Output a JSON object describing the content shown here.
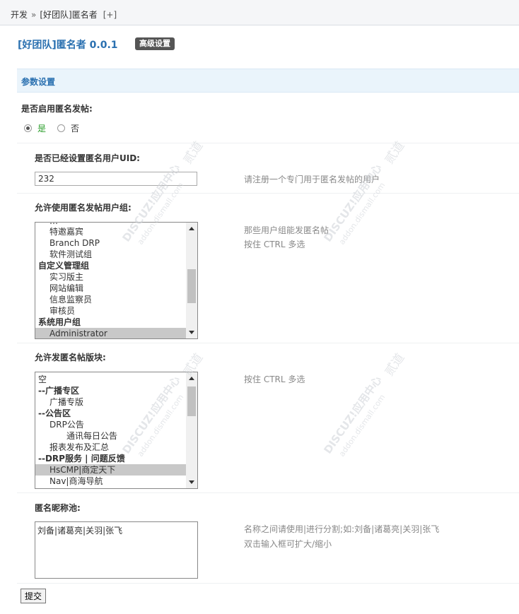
{
  "breadcrumb": {
    "root": "开发",
    "separator": "»",
    "current": "[好团队]匿名者",
    "add": "[+]"
  },
  "header": {
    "title": "[好团队]匿名者 0.0.1",
    "advanced_button": "高级设置"
  },
  "section": {
    "title": "参数设置"
  },
  "enable_anonymous": {
    "label": "是否启用匿名发帖:",
    "options": [
      {
        "label": "是",
        "selected": true
      },
      {
        "label": "否",
        "selected": false
      }
    ]
  },
  "uid_setting": {
    "label": "是否已经设置匿名用户UID:",
    "value": "232",
    "tip": "请注册一个专门用于匿名发帖的用户"
  },
  "allowed_groups": {
    "label": "允许使用匿名发帖用户组:",
    "tip_line1": "那些用户组能发匿名帖",
    "tip_line2": "按住 CTRL 多选",
    "items": [
      {
        "label": "特邀嘉宾",
        "level": "lvl1",
        "selected": false
      },
      {
        "label": "Branch DRP",
        "level": "lvl1",
        "selected": false
      },
      {
        "label": "软件测试组",
        "level": "lvl1",
        "selected": false
      },
      {
        "label": "自定义管理组",
        "level": "grp",
        "selected": false
      },
      {
        "label": "实习版主",
        "level": "lvl1",
        "selected": false
      },
      {
        "label": "网站编辑",
        "level": "lvl1",
        "selected": false
      },
      {
        "label": "信息监察员",
        "level": "lvl1",
        "selected": false
      },
      {
        "label": "审核员",
        "level": "lvl1",
        "selected": false
      },
      {
        "label": "系统用户组",
        "level": "grp",
        "selected": false
      },
      {
        "label": "Administrator",
        "level": "lvl1",
        "selected": true
      }
    ]
  },
  "allowed_forums": {
    "label": "允许发匿名帖版块:",
    "tip": "按住 CTRL 多选",
    "items": [
      {
        "label": "空",
        "level": "grp0",
        "selected": false
      },
      {
        "label": "--广播专区",
        "level": "grp",
        "selected": false
      },
      {
        "label": "广播专版",
        "level": "lvl1",
        "selected": false
      },
      {
        "label": "--公告区",
        "level": "grp",
        "selected": false
      },
      {
        "label": "DRP公告",
        "level": "lvl1",
        "selected": false
      },
      {
        "label": "通讯每日公告",
        "level": "lvl2",
        "selected": false
      },
      {
        "label": "报表发布及汇总",
        "level": "lvl1",
        "selected": false
      },
      {
        "label": "--DRP服务 | 问题反馈",
        "level": "grp",
        "selected": false
      },
      {
        "label": "HsCMP|商定天下",
        "level": "lvl1",
        "selected": true
      },
      {
        "label": "Nav|商海导航",
        "level": "lvl1",
        "selected": false
      }
    ]
  },
  "nickname_pool": {
    "label": "匿名昵称池:",
    "value": "刘备|诸葛亮|关羽|张飞",
    "tip_line1": "名称之间请使用|进行分割;如:刘备|诸葛亮|关羽|张飞",
    "tip_line2": "双击输入框可扩大/缩小"
  },
  "submit_label": "提交",
  "watermark": {
    "brand": "DISCUZ!应用中心",
    "site": "addon.dismall.com",
    "mark": "贰道"
  }
}
